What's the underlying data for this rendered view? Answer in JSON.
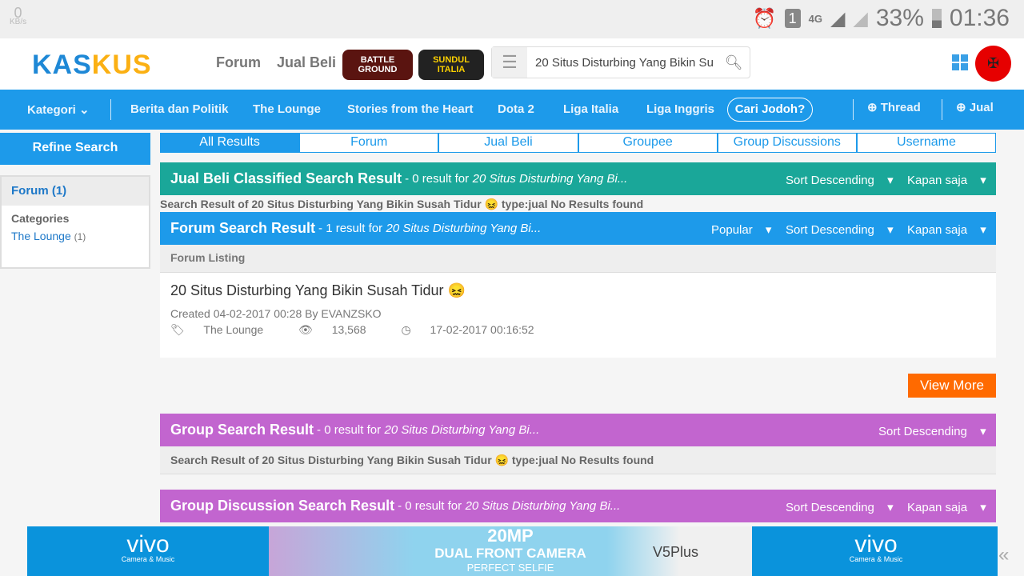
{
  "status": {
    "speed": "0",
    "speed_unit": "KB/s",
    "sim": "1",
    "network": "4G",
    "battery": "33%",
    "time": "01:36"
  },
  "header": {
    "logo_a": "KAS",
    "logo_b": "KUS",
    "links": [
      "Forum",
      "Jual Beli"
    ],
    "badges": [
      "BATTLE GROUND",
      "SUNDUL ITALIA"
    ],
    "search_value": "20 Situs Disturbing Yang Bikin Su"
  },
  "nav": {
    "kategori": "Kategori",
    "items": [
      "Berita dan Politik",
      "The Lounge",
      "Stories from the Heart",
      "Dota 2",
      "Liga Italia",
      "Liga Inggris"
    ],
    "jodoh": "Cari Jodoh?",
    "thread": "Thread",
    "jual": "Jual"
  },
  "sidebar": {
    "refine": "Refine Search",
    "forum": "Forum (1)",
    "categories": "Categories",
    "category": "The Lounge",
    "category_count": "(1)"
  },
  "tabs": [
    "All Results",
    "Forum",
    "Jual Beli",
    "Groupee",
    "Group Discussions",
    "Username"
  ],
  "jualbeli": {
    "title": "Jual Beli Classified Search Result",
    "summary": "- 0 result for",
    "query": "20 Situs Disturbing Yang Bi...",
    "sort": "Sort Descending",
    "time": "Kapan saja",
    "note": "Search Result of 20 Situs Disturbing Yang Bikin Susah Tidur 😖 type:jual No Results found"
  },
  "forum": {
    "title": "Forum Search Result",
    "summary": "- 1 result for",
    "query": "20 Situs Disturbing Yang Bi...",
    "popular": "Popular",
    "sort": "Sort Descending",
    "time": "Kapan saja",
    "listing": "Forum Listing",
    "result": {
      "title": "20 Situs Disturbing Yang Bikin Susah Tidur 😖",
      "created": "Created 04-02-2017 00:28 By EVANZSKO",
      "category": "The Lounge",
      "views": "13,568",
      "last": "17-02-2017 00:16:52"
    },
    "view_more": "View More"
  },
  "group": {
    "title": "Group Search Result",
    "summary": "- 0 result for",
    "query": "20 Situs Disturbing Yang Bi...",
    "sort": "Sort Descending",
    "note": "Search Result of 20 Situs Disturbing Yang Bikin Susah Tidur 😖 type:jual No Results found"
  },
  "discussion": {
    "title": "Group Discussion Search Result",
    "summary": "- 0 result for",
    "query": "20 Situs Disturbing Yang Bi...",
    "sort": "Sort Descending",
    "time": "Kapan saja"
  },
  "ad": {
    "brand": "vivo",
    "tag": "Camera & Music",
    "line1": "20MP",
    "line2": "DUAL FRONT CAMERA",
    "line3": "PERFECT SELFIE",
    "model": "V5Plus"
  },
  "colors": {
    "nav": "#1d9aea",
    "jualbeli": "#1aa799",
    "group": "#c265cf",
    "view_more": "#ff6a00"
  }
}
